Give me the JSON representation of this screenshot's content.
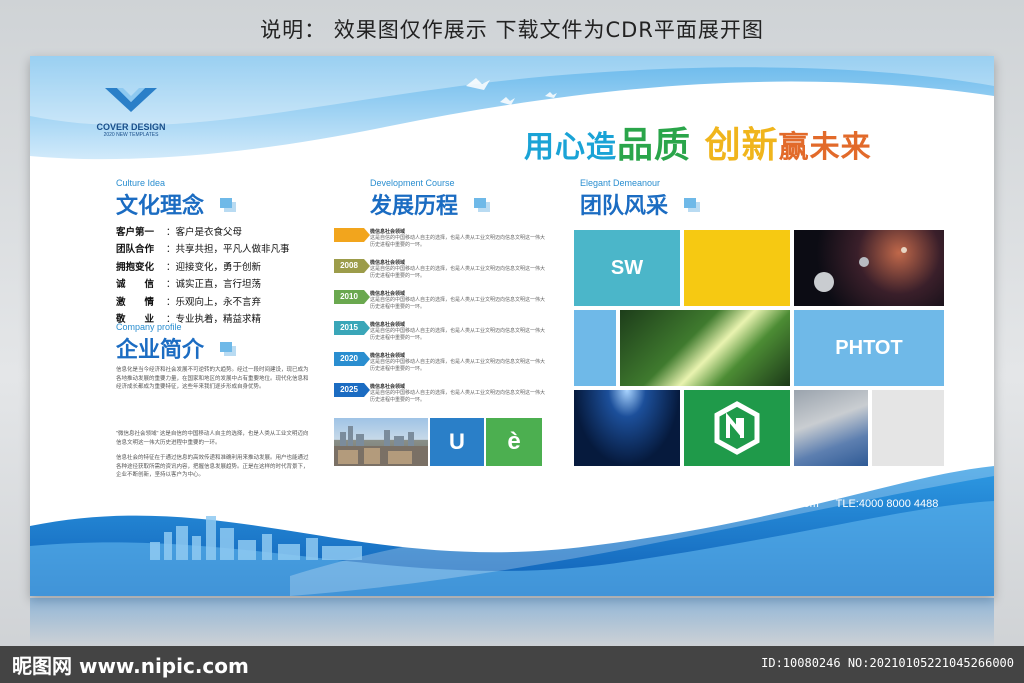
{
  "caption": "说明： 效果图仅作展示  下载文件为CDR平面展开图",
  "logo": {
    "name": "COVER DESIGN",
    "sub": "2020 NEW TEMPLATES"
  },
  "slogan": {
    "part1": "用心造",
    "part2": "品质",
    "part3": "创新",
    "part4": "赢未来"
  },
  "culture": {
    "en": "Culture Idea",
    "cn": "文化理念",
    "rows": [
      {
        "k": "客户第一",
        "v": "：客户是衣食父母"
      },
      {
        "k": "团队合作",
        "v": "：共享共担，平凡人做非凡事"
      },
      {
        "k": "拥抱变化",
        "v": "：迎接变化，勇于创新"
      },
      {
        "k": "诚　　信",
        "v": "：诚实正直，言行坦荡"
      },
      {
        "k": "激　　情",
        "v": "：乐观向上，永不言弃"
      },
      {
        "k": "敬　　业",
        "v": "：专业执着，精益求精"
      }
    ]
  },
  "company": {
    "en": "Company profile",
    "cn": "企业简介",
    "para1": "信息化是当今经济和社会发展不可逆转的大趋势。经过一段时间建设，现已成为各地推动发展的重要力量，在国家和地区的发展中占有重要地位。现代化信息和经济成长都成为重要特征，这些年来我们逐步形成自身优势。",
    "para2": "\"微信息社会领域\" 这是自信的中国移动人自主的选择，也是人类从工业文明迈向信息文明这一伟大历史进程中重要的一环。",
    "para3": "信息社会的特征在于通过信息的高效传递和准确利用来推动发展。用户也能通过各种途径获取所需的资讯内容，把握信息发展趋势。正是在这样的时代背景下，企业不断创新，坚持以客户为中心。"
  },
  "development": {
    "en": "Development Course",
    "cn": "发展历程",
    "items": [
      {
        "year": "",
        "color": "#f2a51d",
        "title": "微信息社会领域",
        "desc": "这是自信的中国移动人自主的选择，也是人类从工业文明迈向信息文明这一伟大历史进程中重要的一环。"
      },
      {
        "year": "2008",
        "color": "#9c9c4a",
        "title": "微信息社会领域",
        "desc": "这是自信的中国移动人自主的选择，也是人类从工业文明迈向信息文明这一伟大历史进程中重要的一环。"
      },
      {
        "year": "2010",
        "color": "#6aa84f",
        "title": "微信息社会领域",
        "desc": "这是自信的中国移动人自主的选择，也是人类从工业文明迈向信息文明这一伟大历史进程中重要的一环。"
      },
      {
        "year": "2015",
        "color": "#3aa6b8",
        "title": "微信息社会领域",
        "desc": "这是自信的中国移动人自主的选择，也是人类从工业文明迈向信息文明这一伟大历史进程中重要的一环。"
      },
      {
        "year": "2020",
        "color": "#2a8ed0",
        "title": "微信息社会领域",
        "desc": "这是自信的中国移动人自主的选择，也是人类从工业文明迈向信息文明这一伟大历史进程中重要的一环。"
      },
      {
        "year": "2025",
        "color": "#1b6cc2",
        "title": "微信息社会领域",
        "desc": "这是自信的中国移动人自主的选择，也是人类从工业文明迈向信息文明这一伟大历史进程中重要的一环。"
      }
    ],
    "tile_u": "U",
    "tile_e": "è"
  },
  "team": {
    "en": "Elegant Demeanour",
    "cn": "团队风采",
    "sw": "SW",
    "photo": "PHTOT"
  },
  "contact": {
    "site": "www.nipic.com",
    "tel": "TLE:4000 8000 4488"
  },
  "watermark": {
    "left": "昵图网 www.nipic.com",
    "right": "ID:10080246 NO:20210105221045266000"
  },
  "colors": {
    "primary": "#1b6cc2",
    "teal": "#4bb6c9",
    "yellow": "#f6c912",
    "lightblue": "#6fb9e8",
    "green": "#1f9a4a"
  }
}
